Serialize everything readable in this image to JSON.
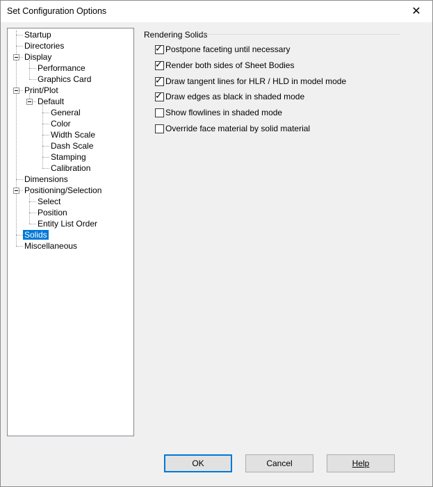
{
  "window": {
    "title": "Set Configuration Options",
    "close_glyph": "✕"
  },
  "tree": {
    "items": [
      {
        "label": "Startup",
        "level": 0
      },
      {
        "label": "Directories",
        "level": 0
      },
      {
        "label": "Display",
        "level": 0,
        "expanded": true
      },
      {
        "label": "Performance",
        "level": 1
      },
      {
        "label": "Graphics Card",
        "level": 1
      },
      {
        "label": "Print/Plot",
        "level": 0,
        "expanded": true
      },
      {
        "label": "Default",
        "level": 1,
        "expanded": true
      },
      {
        "label": "General",
        "level": 2
      },
      {
        "label": "Color",
        "level": 2
      },
      {
        "label": "Width Scale",
        "level": 2
      },
      {
        "label": "Dash Scale",
        "level": 2
      },
      {
        "label": "Stamping",
        "level": 2
      },
      {
        "label": "Calibration",
        "level": 2
      },
      {
        "label": "Dimensions",
        "level": 0
      },
      {
        "label": "Positioning/Selection",
        "level": 0,
        "expanded": true
      },
      {
        "label": "Select",
        "level": 1
      },
      {
        "label": "Position",
        "level": 1
      },
      {
        "label": "Entity List Order",
        "level": 1
      },
      {
        "label": "Solids",
        "level": 0,
        "selected": true
      },
      {
        "label": "Miscellaneous",
        "level": 0
      }
    ]
  },
  "panel": {
    "group_title": "Rendering Solids",
    "options": [
      {
        "label": "Postpone faceting until necessary",
        "checked": true
      },
      {
        "label": "Render both sides of Sheet Bodies",
        "checked": true
      },
      {
        "label": "Draw tangent lines for HLR / HLD in model mode",
        "checked": true
      },
      {
        "label": "Draw edges as black in shaded mode",
        "checked": true
      },
      {
        "label": "Show flowlines in shaded mode",
        "checked": false
      },
      {
        "label": "Override face material by solid material",
        "checked": false
      }
    ]
  },
  "buttons": {
    "ok": "OK",
    "cancel": "Cancel",
    "help": "Help"
  },
  "colors": {
    "selection": "#0078d7",
    "window_bg": "#f0f0f0"
  }
}
